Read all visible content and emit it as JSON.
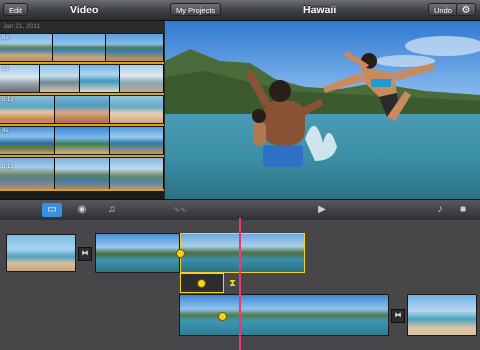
{
  "topbar": {
    "edit_label": "Edit",
    "browser_title": "Video",
    "projects_label": "My Projects",
    "project_title": "Hawaii",
    "undo_label": "Undo",
    "settings_icon": "gear-icon"
  },
  "browser": {
    "date_header": "Jan 21, 2011",
    "rows": [
      {
        "duration": "6s"
      },
      {
        "duration": "3s"
      },
      {
        "duration": "5.1s"
      },
      {
        "duration": "4s"
      },
      {
        "duration": "8.1s"
      }
    ]
  },
  "mediabar": {
    "icons": [
      "video-icon",
      "camera-icon",
      "music-note-icon"
    ],
    "right_icons": [
      "play-icon",
      "microphone-icon",
      "record-camera-icon"
    ],
    "accent": "#3b8fe0"
  },
  "timeline": {
    "playhead_color": "#e8386f",
    "handle_color": "#f6d21e"
  }
}
